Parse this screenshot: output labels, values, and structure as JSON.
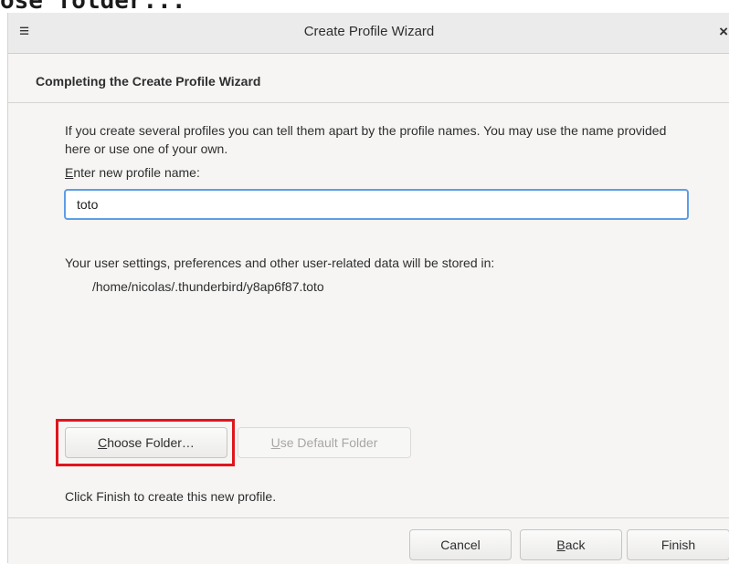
{
  "caption": {
    "text": "ose folder..."
  },
  "window": {
    "title": "Create Profile Wizard",
    "menu_icon": "hamburger-menu-icon",
    "close_icon": "close-icon",
    "close_glyph": "×",
    "menu_glyph": "≡"
  },
  "header": {
    "heading": "Completing the Create Profile Wizard"
  },
  "content": {
    "intro": "If you create several profiles you can tell them apart by the profile names. You may use the name provided here or use one of your own.",
    "name_label_mnemonic": "E",
    "name_label_rest": "nter new profile name:",
    "name_value": "toto",
    "storage_text": "Your user settings, preferences and other user-related data will be stored in:",
    "storage_path": "/home/nicolas/.thunderbird/y8ap6f87.toto",
    "choose_folder_mnemonic": "C",
    "choose_folder_rest": "hoose Folder…",
    "use_default_mnemonic": "U",
    "use_default_rest": "se Default Folder",
    "finish_note": "Click Finish to create this new profile."
  },
  "footer": {
    "cancel": "Cancel",
    "back_mnemonic": "B",
    "back_rest": "ack",
    "finish": "Finish"
  },
  "colors": {
    "highlight": "#e0151d",
    "focus_border": "#5d9ee6"
  }
}
